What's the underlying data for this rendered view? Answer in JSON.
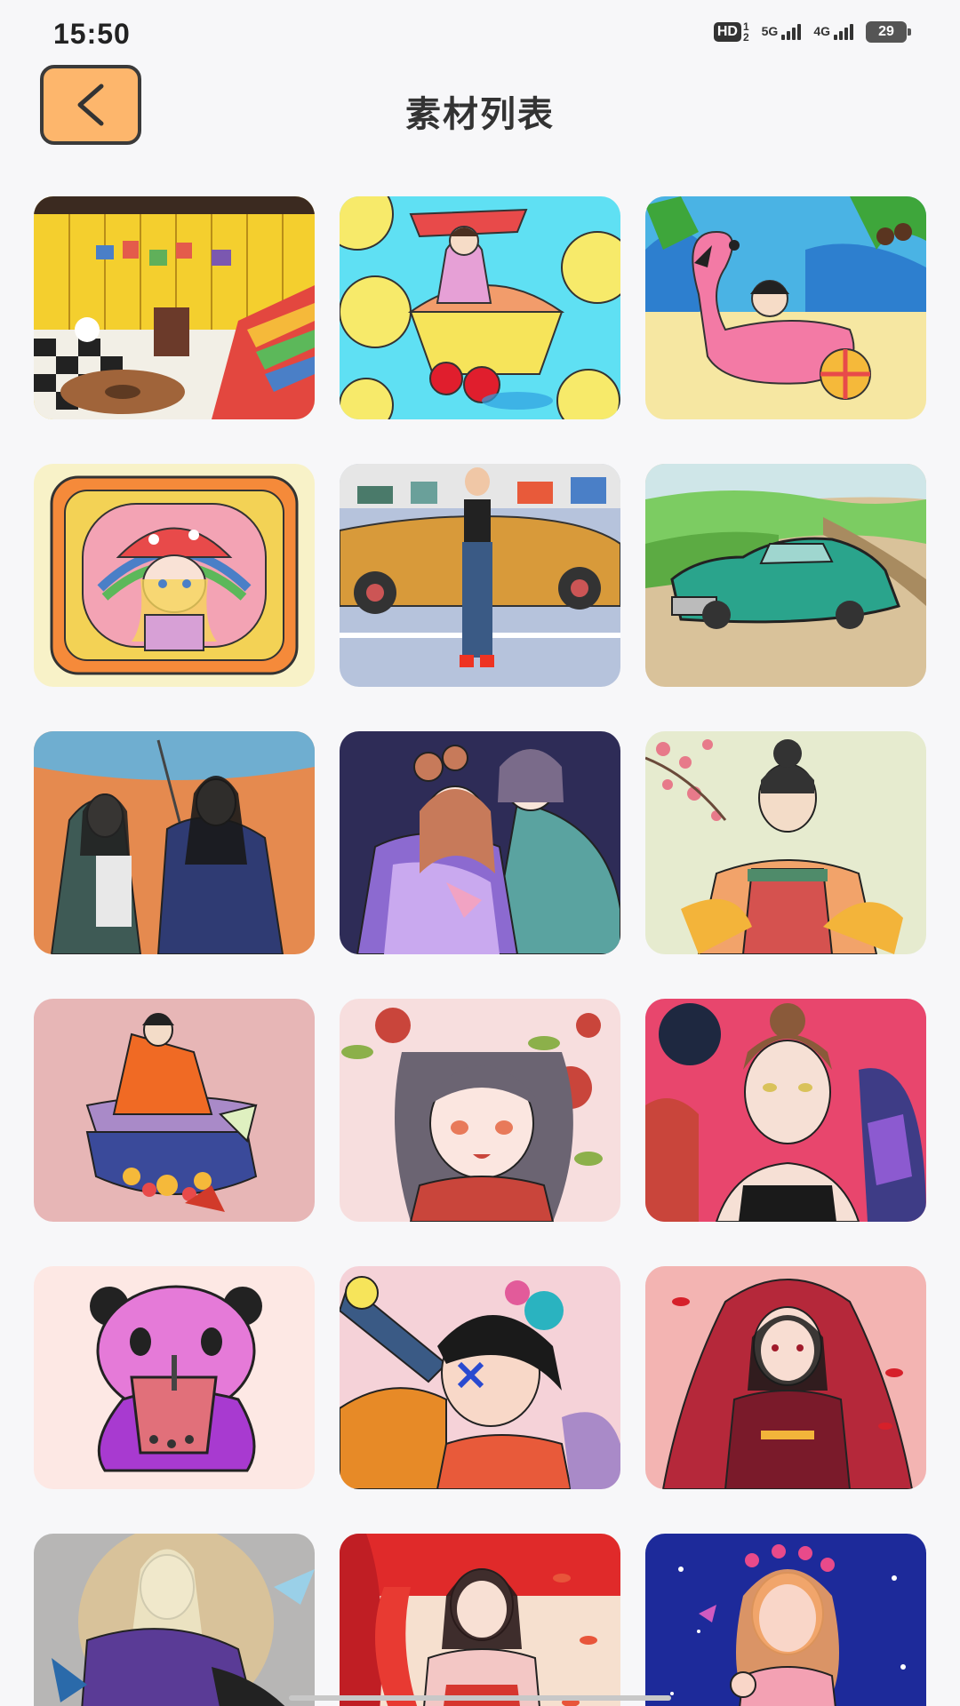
{
  "status_bar": {
    "time": "15:50",
    "hd_label": "HD",
    "hd_sub_top": "1",
    "hd_sub_bottom": "2",
    "net1": "5G",
    "net2": "4G",
    "battery": "29"
  },
  "header": {
    "back_icon": "chevron-left-icon",
    "title": "素材列表"
  },
  "materials": [
    {
      "name": "rainbow-room",
      "bg": "#f4cf2e",
      "accent": "#a05a2c"
    },
    {
      "name": "lemon-girl",
      "bg": "#5fe0f3",
      "accent": "#e84a4a"
    },
    {
      "name": "flamingo-float",
      "bg": "#f6e7a2",
      "accent": "#ee5c8c"
    },
    {
      "name": "mushroom-girl",
      "bg": "#f8f2c8",
      "accent": "#f3a3b4"
    },
    {
      "name": "taxi-girl",
      "bg": "#b6c3dc",
      "accent": "#d89a3a"
    },
    {
      "name": "vintage-car",
      "bg": "#7ccc62",
      "accent": "#2aa48c"
    },
    {
      "name": "umbrella-couple",
      "bg": "#e58a4f",
      "accent": "#2f3b73"
    },
    {
      "name": "hanfu-couple",
      "bg": "#2e2c57",
      "accent": "#8c6ad0"
    },
    {
      "name": "blossom-lady",
      "bg": "#e6ebcf",
      "accent": "#d5524f"
    },
    {
      "name": "kimono-jar",
      "bg": "#e7b6b6",
      "accent": "#f06a24"
    },
    {
      "name": "flower-girl",
      "bg": "#f7dede",
      "accent": "#c9453b"
    },
    {
      "name": "woman-portrait",
      "bg": "#e8466d",
      "accent": "#3e3c86"
    },
    {
      "name": "panda-tea",
      "bg": "#fde8e4",
      "accent": "#e57ad8"
    },
    {
      "name": "telescope-girl",
      "bg": "#f5d2d8",
      "accent": "#e78a27"
    },
    {
      "name": "red-veil",
      "bg": "#f3b4b2",
      "accent": "#b5283a"
    },
    {
      "name": "elf-purple",
      "bg": "#b7b6b5",
      "accent": "#5a3b96"
    },
    {
      "name": "red-dancer",
      "bg": "#f6e0cf",
      "accent": "#d6372f"
    },
    {
      "name": "starry-girl",
      "bg": "#1d2a9a",
      "accent": "#f3a1b3"
    }
  ]
}
